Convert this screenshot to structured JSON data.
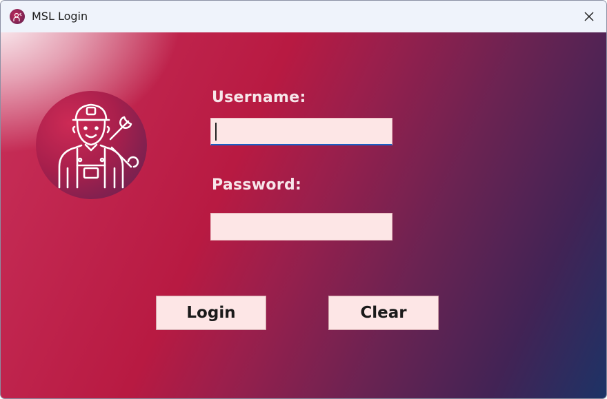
{
  "window": {
    "title": "MSL Login",
    "app_icon": "mechanic-app-icon",
    "close_icon": "close-icon"
  },
  "form": {
    "username_label": "Username:",
    "password_label": "Password:",
    "username_value": "",
    "password_value": ""
  },
  "avatar": {
    "icon": "mechanic-icon"
  },
  "buttons": {
    "login_label": "Login",
    "clear_label": "Clear"
  },
  "colors": {
    "accent": "#1b5fc4",
    "field_bg": "#fde6e6",
    "gradient_start": "#b81a42",
    "gradient_end": "#1d3366"
  }
}
